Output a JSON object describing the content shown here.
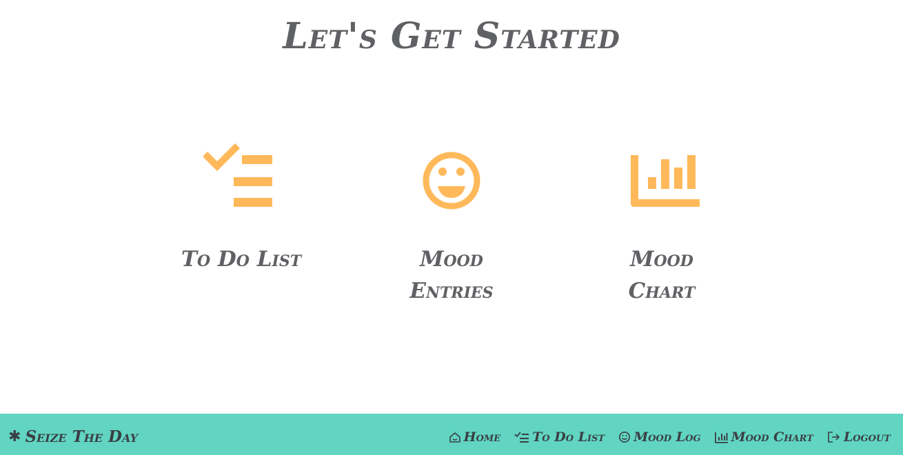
{
  "page": {
    "title": "Let's Get Started"
  },
  "cards": [
    {
      "label": "To Do List",
      "icon": "checklist-icon"
    },
    {
      "label": "Mood Entries",
      "icon": "smiley-face-icon"
    },
    {
      "label": "Mood Chart",
      "icon": "bar-chart-icon"
    }
  ],
  "navbar": {
    "brand": {
      "icon": "asterisk-icon",
      "label": "Seize The Day"
    },
    "links": [
      {
        "icon": "home-icon",
        "label": "Home"
      },
      {
        "icon": "checklist-icon",
        "label": "To Do List"
      },
      {
        "icon": "smiley-face-icon",
        "label": "Mood Log"
      },
      {
        "icon": "bar-chart-icon",
        "label": "Mood Chart"
      },
      {
        "icon": "logout-icon",
        "label": "Logout"
      }
    ]
  },
  "colors": {
    "accent": "#ffb95a",
    "navbar_bg": "#61d5c2",
    "text": "#5f6164",
    "nav_text": "#3a3f44"
  }
}
